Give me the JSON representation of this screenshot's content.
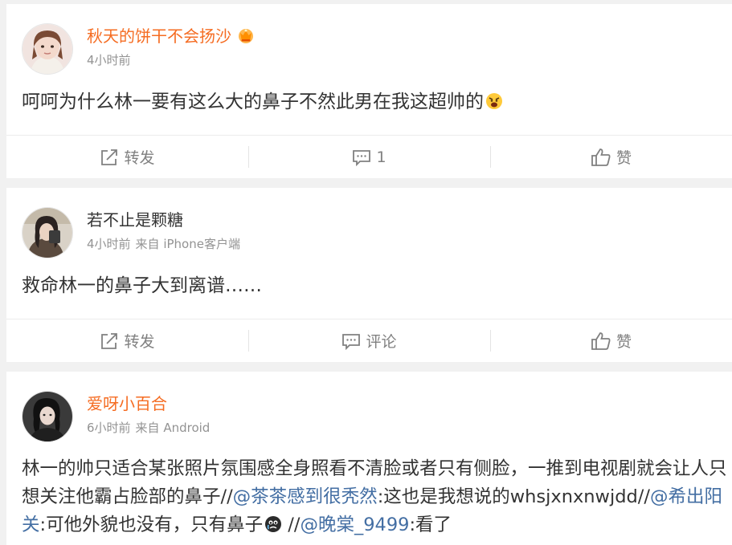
{
  "posts": [
    {
      "name": "秋天的饼干不会扬沙",
      "time": "4小时前",
      "device": "",
      "text_parts": [
        "呵呵为什么林一要有这么大的鼻子不然此男在我这超帅的"
      ],
      "actions": {
        "repost": "转发",
        "comment": "1",
        "like": "赞"
      }
    },
    {
      "name": "若不止是颗糖",
      "time": "4小时前",
      "device": "来自 iPhone客户端",
      "text_parts": [
        "救命林一的鼻子大到离谱……"
      ],
      "actions": {
        "repost": "转发",
        "comment": "评论",
        "like": "赞"
      }
    },
    {
      "name": "爱呀小百合",
      "time": "6小时前",
      "device": "来自 Android",
      "text": {
        "p1": "林一的帅只适合某张照片氛围感全身照看不清脸或者只有侧脸，一推到电视剧就会让人只想关注他霸占脸部的鼻子//",
        "m1": "@茶茶感到很秃然",
        "p2": ":这也是我想说的whsjxnxnwjdd//",
        "m2": "@希出阳关",
        "p3": ":可他外貌也没有，只有鼻子",
        "p4": " //",
        "m3": "@晚棠_9499",
        "p5": ":看了"
      }
    }
  ],
  "colors": {
    "vip_name": "#f56c22",
    "mention": "#436ea3",
    "meta": "#939393"
  },
  "icons": {
    "repost": "share-icon",
    "comment": "comment-icon",
    "like": "thumbs-up-icon",
    "vip": "crown-badge-icon"
  }
}
